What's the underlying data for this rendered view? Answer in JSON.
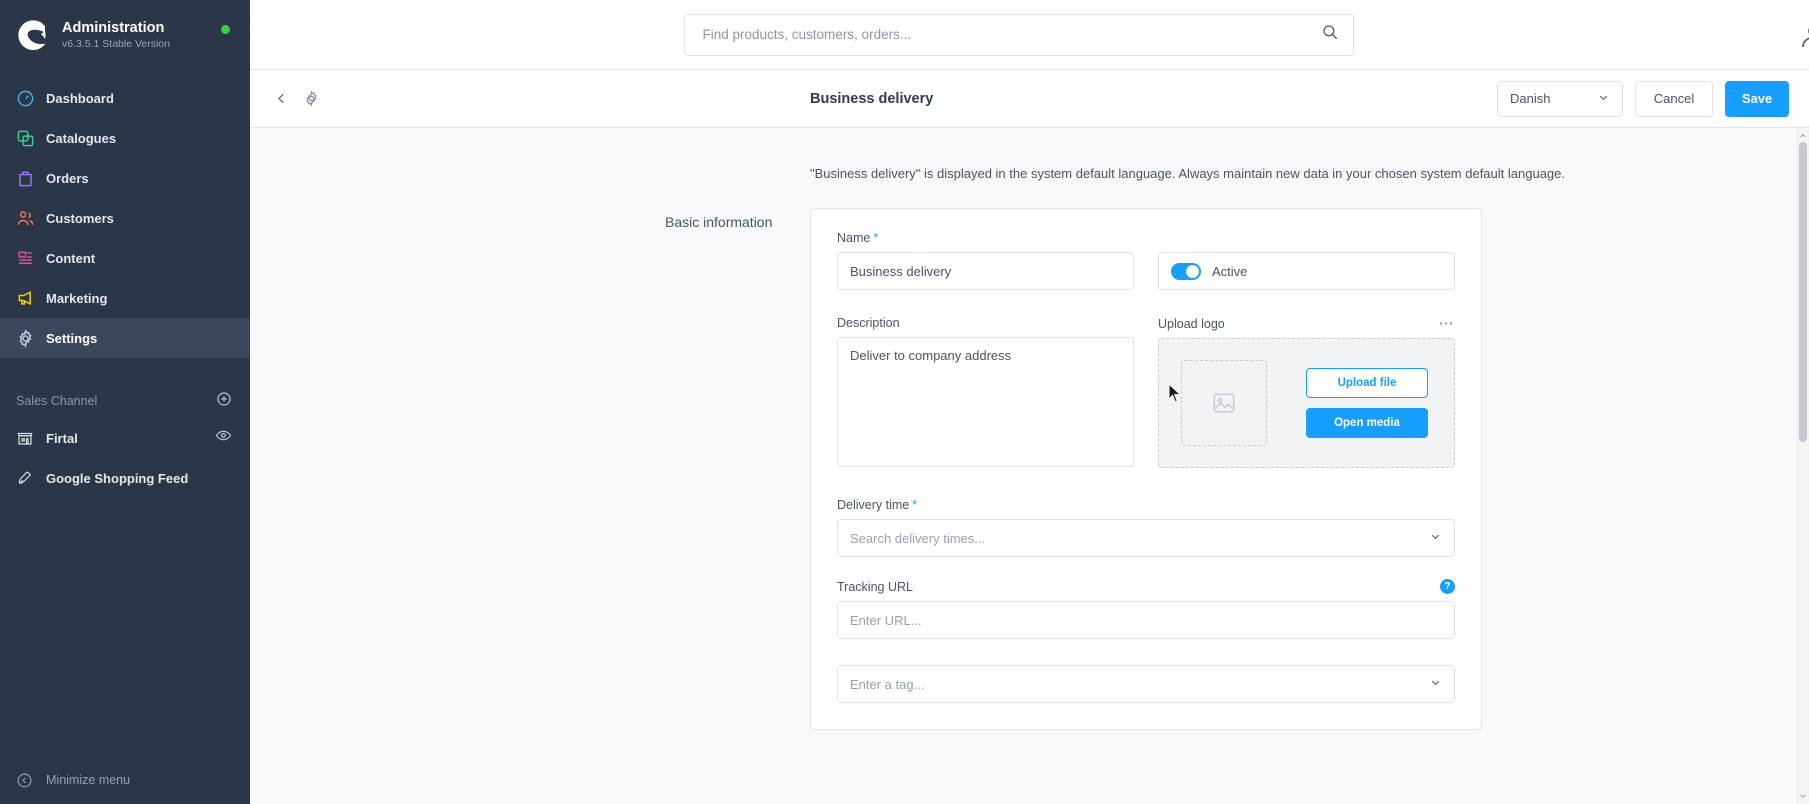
{
  "sidebar": {
    "brand": {
      "title": "Administration",
      "version": "v6.3.5.1 Stable Version",
      "status_color": "#37d046",
      "logo_icon": "shopware-logo-icon"
    },
    "nav": [
      {
        "label": "Dashboard",
        "icon": "dashboard-gauge-icon",
        "color": "#4dabf5",
        "active": false
      },
      {
        "label": "Catalogues",
        "icon": "catalogues-layers-icon",
        "color": "#3ecf8e",
        "active": false
      },
      {
        "label": "Orders",
        "icon": "orders-bag-icon",
        "color": "#9a7cf5",
        "active": false
      },
      {
        "label": "Customers",
        "icon": "customers-people-icon",
        "color": "#ef7c57",
        "active": false
      },
      {
        "label": "Content",
        "icon": "content-page-icon",
        "color": "#e94f9b",
        "active": false
      },
      {
        "label": "Marketing",
        "icon": "marketing-megaphone-icon",
        "color": "#ecd400",
        "active": false
      },
      {
        "label": "Settings",
        "icon": "settings-gear-icon",
        "color": "#c6cdd8",
        "active": true
      }
    ],
    "sales_channel": {
      "heading": "Sales Channel",
      "add_icon": "plus-circle-icon",
      "items": [
        {
          "label": "Firtal",
          "icon": "storefront-icon",
          "action_icon": "eye-icon"
        },
        {
          "label": "Google Shopping Feed",
          "icon": "rocket-icon",
          "action_icon": ""
        }
      ]
    },
    "minimize": {
      "label": "Minimize menu",
      "icon": "chevron-left-circle-icon"
    }
  },
  "topbar": {
    "search": {
      "placeholder": "Find products, customers, orders...",
      "value": "",
      "icon": "search-icon"
    }
  },
  "pagehead": {
    "back_icon": "chevron-left-icon",
    "settings_icon": "gear-icon",
    "title": "Business delivery",
    "language": {
      "value": "Danish",
      "chevron_icon": "chevron-down-icon"
    },
    "cancel_label": "Cancel",
    "save_label": "Save",
    "save_color": "#189eff"
  },
  "content": {
    "notice": "\"Business delivery\" is displayed in the system default language. Always maintain new data in your chosen system default language.",
    "section_label": "Basic information",
    "fields": {
      "name": {
        "label": "Name",
        "required": "*",
        "value": "Business delivery"
      },
      "active": {
        "label": "Active",
        "state": "on"
      },
      "description": {
        "label": "Description",
        "value": "Deliver to company address"
      },
      "upload": {
        "label": "Upload logo",
        "context_icon": "ellipsis-icon",
        "placeholder_icon": "image-placeholder-icon",
        "upload_file_label": "Upload file",
        "open_media_label": "Open media"
      },
      "delivery_time": {
        "label": "Delivery time",
        "required": "*",
        "placeholder": "Search delivery times...",
        "chevron_icon": "chevron-down-icon"
      },
      "tracking_url": {
        "label": "Tracking URL",
        "placeholder": "Enter URL...",
        "help_icon": "help-badge-icon",
        "help_label": "?"
      },
      "tags": {
        "placeholder": "Enter a tag...",
        "chevron_icon": "chevron-down-icon"
      }
    }
  }
}
